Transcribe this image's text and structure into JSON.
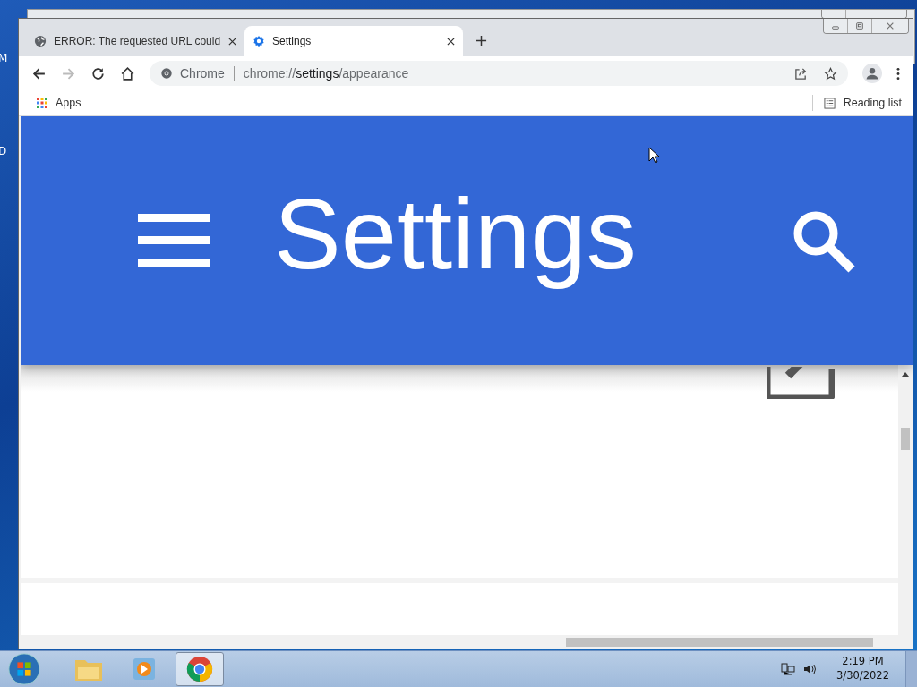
{
  "desktop_labels": [
    "M",
    "D"
  ],
  "tabs": [
    {
      "title": "ERROR: The requested URL could",
      "selected": false
    },
    {
      "title": "Settings",
      "selected": true
    }
  ],
  "toolbar": {
    "forward_disabled": true
  },
  "omnibox": {
    "origin": "Chrome",
    "url_scheme": "chrome://",
    "url_host": "settings",
    "url_path": "/appearance"
  },
  "bookmarks": [
    {
      "label": "Apps"
    }
  ],
  "reading_list": "Reading list",
  "page": {
    "title": "Settings"
  },
  "taskbar": {
    "apps": [
      {
        "kind": "explorer",
        "selected": false
      },
      {
        "kind": "media",
        "selected": false
      },
      {
        "kind": "chrome",
        "selected": true
      }
    ],
    "time": "2:19 PM",
    "date": "3/30/2022"
  }
}
